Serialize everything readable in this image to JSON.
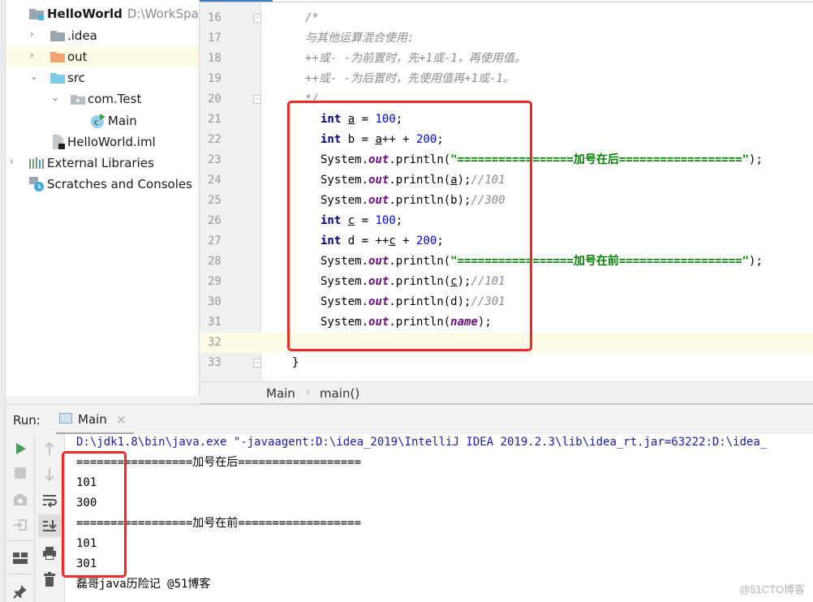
{
  "project": {
    "items": [
      {
        "label": "HelloWorld",
        "hint": "D:\\WorkSpac",
        "icon": "module-folder-icon",
        "expanded": true,
        "level": 0
      },
      {
        "label": ".idea",
        "icon": "folder-icon",
        "expanded": false,
        "level": 1
      },
      {
        "label": "out",
        "icon": "excluded-folder-icon",
        "expanded": false,
        "level": 1,
        "highlighted": true
      },
      {
        "label": "src",
        "icon": "source-folder-icon",
        "expanded": true,
        "level": 1
      },
      {
        "label": "com.Test",
        "icon": "package-icon",
        "expanded": true,
        "level": 2
      },
      {
        "label": "Main",
        "icon": "java-class-icon",
        "level": 3
      },
      {
        "label": "HelloWorld.iml",
        "icon": "iml-file-icon",
        "level": 1
      },
      {
        "label": "External Libraries",
        "icon": "libraries-icon",
        "expanded": false,
        "level": 0
      },
      {
        "label": "Scratches and Consoles",
        "icon": "scratches-icon",
        "level": 0
      }
    ]
  },
  "editor": {
    "lines": [
      {
        "n": "16",
        "text": "/*"
      },
      {
        "n": "17",
        "text": "与其他运算混合使用:"
      },
      {
        "n": "18",
        "text": "++或- -为前置时，先+1或-1，再使用值。"
      },
      {
        "n": "19",
        "text": "++或- -为后置时，先使用值再+1或-1。"
      },
      {
        "n": "20",
        "text": "*/"
      },
      {
        "n": "21",
        "kw": "int",
        "var": "a",
        "rest": " = ",
        "num": "100",
        "end": ";"
      },
      {
        "n": "22",
        "kw": "int",
        "pre": " b = ",
        "var": "a",
        "rest": "++ + ",
        "num": "200",
        "end": ";"
      },
      {
        "n": "23",
        "sys": "System.",
        "fld": "out",
        "call": ".println(",
        "str": "\"=================加号在后==================\"",
        "end": ");"
      },
      {
        "n": "24",
        "sys": "System.",
        "fld": "out",
        "call": ".println(",
        "arg": "a",
        "end": ");",
        "cmt": "//101"
      },
      {
        "n": "25",
        "sys": "System.",
        "fld": "out",
        "call": ".println(",
        "arg": "b",
        "end": ");",
        "cmt": "//300"
      },
      {
        "n": "26",
        "kw": "int",
        "var": "c",
        "rest": " = ",
        "num": "100",
        "end": ";"
      },
      {
        "n": "27",
        "kw": "int",
        "pre": " d = ++",
        "var": "c",
        "rest": " + ",
        "num": "200",
        "end": ";"
      },
      {
        "n": "28",
        "sys": "System.",
        "fld": "out",
        "call": ".println(",
        "str": "\"=================加号在前==================\"",
        "end": ");"
      },
      {
        "n": "29",
        "sys": "System.",
        "fld": "out",
        "call": ".println(",
        "arg": "c",
        "end": ");",
        "cmt": "//101"
      },
      {
        "n": "30",
        "sys": "System.",
        "fld": "out",
        "call": ".println(",
        "arg": "d",
        "end": ");",
        "cmt": "//301"
      },
      {
        "n": "31",
        "sys": "System.",
        "fld": "out",
        "call": ".println(",
        "fldarg": "name",
        "end": ");"
      },
      {
        "n": "32",
        "text": ""
      },
      {
        "n": "33",
        "text": "}"
      }
    ]
  },
  "breadcrumb": {
    "items": [
      "Main",
      "main()"
    ],
    "separator": "›"
  },
  "run": {
    "label": "Run:",
    "tab": {
      "label": "Main",
      "close": "×"
    },
    "console": [
      "D:\\jdk1.8\\bin\\java.exe \"-javaagent:D:\\idea_2019\\IntelliJ IDEA 2019.2.3\\lib\\idea_rt.jar=63222:D:\\idea_",
      "=================加号在后==================",
      "101",
      "300",
      "=================加号在前==================",
      "101",
      "301",
      "磊哥java历险记 @51博客"
    ]
  },
  "watermark": "@51CTO博客"
}
